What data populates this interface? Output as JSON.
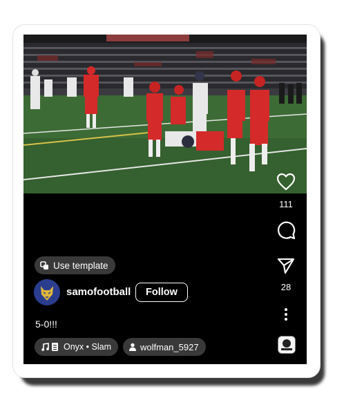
{
  "post": {
    "template_label": "Use template",
    "username": "samofootball",
    "follow_label": "Follow",
    "caption": "5-0!!!",
    "audio_label": "Onyx • Slam",
    "tagged_user": "wolfman_5927",
    "image_description_icon": "football-game-photo"
  },
  "actions": {
    "like_count": "111",
    "comment_count": "",
    "share_count": "28"
  },
  "colors": {
    "background": "#000000",
    "text": "#ffffff",
    "pill": "#3c3c3c",
    "avatar": "#2b3d8f"
  }
}
